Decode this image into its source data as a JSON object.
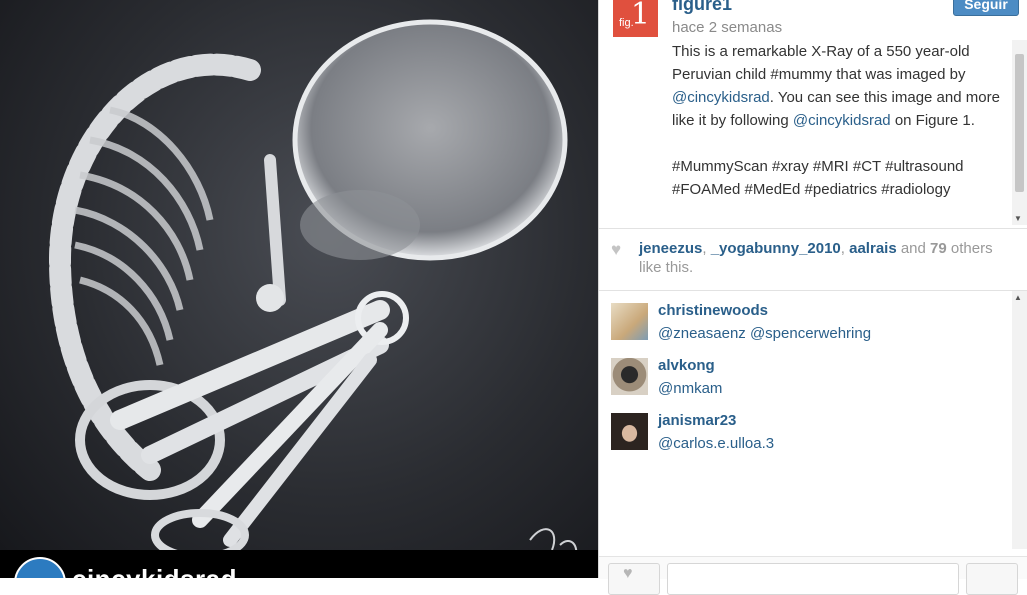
{
  "post": {
    "author": "figure1",
    "follow_label": "Seguir",
    "time": "hace 2 semanas",
    "avatar": {
      "number": "1",
      "label": "fig."
    },
    "caption_parts": [
      "This is a remarkable X-Ray of a 550 year-old Peruvian child #mummy that was imaged by ",
      "@cincykidsrad",
      ". You can see this image and more like it by following ",
      "@cincykidsrad",
      " on Figure 1."
    ],
    "hashtags": "#MummyScan #xray #MRI #CT #ultrasound #FOAMed #MedEd #pediatrics #radiology"
  },
  "photo": {
    "overlay_username": "cincykidsrad"
  },
  "likes": {
    "users": [
      "jeneezus",
      "_yogabunny_2010",
      "aalrais"
    ],
    "and_text": "and",
    "count": "79",
    "suffix": "others like this."
  },
  "comments": [
    {
      "user": "christinewoods",
      "text": "@zneasaenz @spencerwehring",
      "avatar_color": "#c9a87a"
    },
    {
      "user": "alvkong",
      "text": "@nmkam",
      "avatar_color": "#8a7a6a"
    },
    {
      "user": "janismar23",
      "text": "@carlos.e.ulloa.3",
      "avatar_color": "#3a302c"
    }
  ],
  "colors": {
    "link": "#2a5f8a",
    "follow": "#4d8cc4",
    "figure_red": "#e0503e"
  }
}
